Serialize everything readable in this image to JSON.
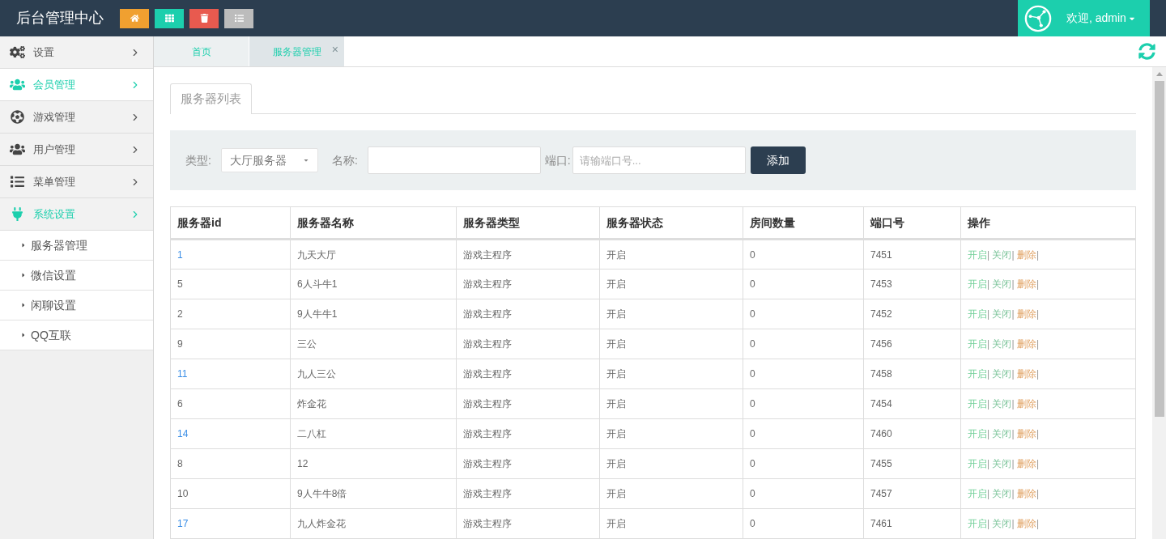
{
  "header": {
    "title": "后台管理中心",
    "quick_buttons": [
      {
        "kind": "home",
        "color": "#f0a030"
      },
      {
        "kind": "grid",
        "color": "#1ccfad"
      },
      {
        "kind": "trash",
        "color": "#e85a4f"
      },
      {
        "kind": "list",
        "color": "#bcbcbc"
      }
    ],
    "user": {
      "welcome": "欢迎, admin"
    }
  },
  "sidebar": {
    "items": [
      {
        "label": "设置",
        "kind": "gears",
        "selected": false,
        "expanded": false
      },
      {
        "label": "会员管理",
        "kind": "users",
        "selected": true,
        "expanded": false
      },
      {
        "label": "游戏管理",
        "kind": "ball",
        "selected": false,
        "expanded": false
      },
      {
        "label": "用户管理",
        "kind": "users",
        "selected": false,
        "expanded": false
      },
      {
        "label": "菜单管理",
        "kind": "list",
        "selected": false,
        "expanded": false
      },
      {
        "label": "系统设置",
        "kind": "plug",
        "selected": false,
        "expanded": true,
        "children": [
          {
            "label": "服务器管理"
          },
          {
            "label": "微信设置"
          },
          {
            "label": "闲聊设置"
          },
          {
            "label": "QQ互联"
          }
        ]
      }
    ]
  },
  "tabs": [
    {
      "label": "首页",
      "selected": false
    },
    {
      "label": "服务器管理",
      "selected": true,
      "close": "×"
    }
  ],
  "panel_tab": "服务器列表",
  "filter": {
    "type_label": "类型:",
    "type_value": "大厅服务器",
    "name_label": "名称:",
    "port_label": "端口:",
    "port_placeholder": "请输端口号...",
    "add_button": "添加"
  },
  "table": {
    "columns": [
      "服务器id",
      "服务器名称",
      "服务器类型",
      "服务器状态",
      "房间数量",
      "端口号",
      "操作"
    ],
    "action_separator": "|",
    "rows": [
      {
        "cells": [
          "1",
          "九天大厅",
          "游戏主程序",
          "开启",
          "0",
          "7451"
        ],
        "highlighted": true,
        "actions": [
          {
            "label": "开启",
            "kind": "open"
          },
          {
            "label": "关闭",
            "kind": "close"
          },
          {
            "label": "删除",
            "kind": "delete"
          }
        ]
      },
      {
        "cells": [
          "5",
          "6人斗牛1",
          "游戏主程序",
          "开启",
          "0",
          "7453"
        ],
        "highlighted": false,
        "actions": [
          {
            "label": "开启",
            "kind": "open"
          },
          {
            "label": "关闭",
            "kind": "close"
          },
          {
            "label": "删除",
            "kind": "delete"
          }
        ]
      },
      {
        "cells": [
          "2",
          "9人牛牛1",
          "游戏主程序",
          "开启",
          "0",
          "7452"
        ],
        "highlighted": false,
        "actions": [
          {
            "label": "开启",
            "kind": "open"
          },
          {
            "label": "关闭",
            "kind": "close"
          },
          {
            "label": "删除",
            "kind": "delete"
          }
        ]
      },
      {
        "cells": [
          "9",
          "三公",
          "游戏主程序",
          "开启",
          "0",
          "7456"
        ],
        "highlighted": false,
        "actions": [
          {
            "label": "开启",
            "kind": "open"
          },
          {
            "label": "关闭",
            "kind": "close"
          },
          {
            "label": "删除",
            "kind": "delete"
          }
        ]
      },
      {
        "cells": [
          "11",
          "九人三公",
          "游戏主程序",
          "开启",
          "0",
          "7458"
        ],
        "highlighted": true,
        "actions": [
          {
            "label": "开启",
            "kind": "open"
          },
          {
            "label": "关闭",
            "kind": "close"
          },
          {
            "label": "删除",
            "kind": "delete"
          }
        ]
      },
      {
        "cells": [
          "6",
          "炸金花",
          "游戏主程序",
          "开启",
          "0",
          "7454"
        ],
        "highlighted": false,
        "actions": [
          {
            "label": "开启",
            "kind": "open"
          },
          {
            "label": "关闭",
            "kind": "close"
          },
          {
            "label": "删除",
            "kind": "delete"
          }
        ]
      },
      {
        "cells": [
          "14",
          "二八杠",
          "游戏主程序",
          "开启",
          "0",
          "7460"
        ],
        "highlighted": true,
        "actions": [
          {
            "label": "开启",
            "kind": "open"
          },
          {
            "label": "关闭",
            "kind": "close"
          },
          {
            "label": "删除",
            "kind": "delete"
          }
        ]
      },
      {
        "cells": [
          "8",
          "12",
          "游戏主程序",
          "开启",
          "0",
          "7455"
        ],
        "highlighted": false,
        "actions": [
          {
            "label": "开启",
            "kind": "open"
          },
          {
            "label": "关闭",
            "kind": "close"
          },
          {
            "label": "删除",
            "kind": "delete"
          }
        ]
      },
      {
        "cells": [
          "10",
          "9人牛牛8倍",
          "游戏主程序",
          "开启",
          "0",
          "7457"
        ],
        "highlighted": false,
        "actions": [
          {
            "label": "开启",
            "kind": "open"
          },
          {
            "label": "关闭",
            "kind": "close"
          },
          {
            "label": "删除",
            "kind": "delete"
          }
        ]
      },
      {
        "cells": [
          "17",
          "九人炸金花",
          "游戏主程序",
          "开启",
          "0",
          "7461"
        ],
        "highlighted": true,
        "actions": [
          {
            "label": "开启",
            "kind": "open"
          },
          {
            "label": "关闭",
            "kind": "close"
          },
          {
            "label": "删除",
            "kind": "delete"
          }
        ]
      }
    ]
  }
}
